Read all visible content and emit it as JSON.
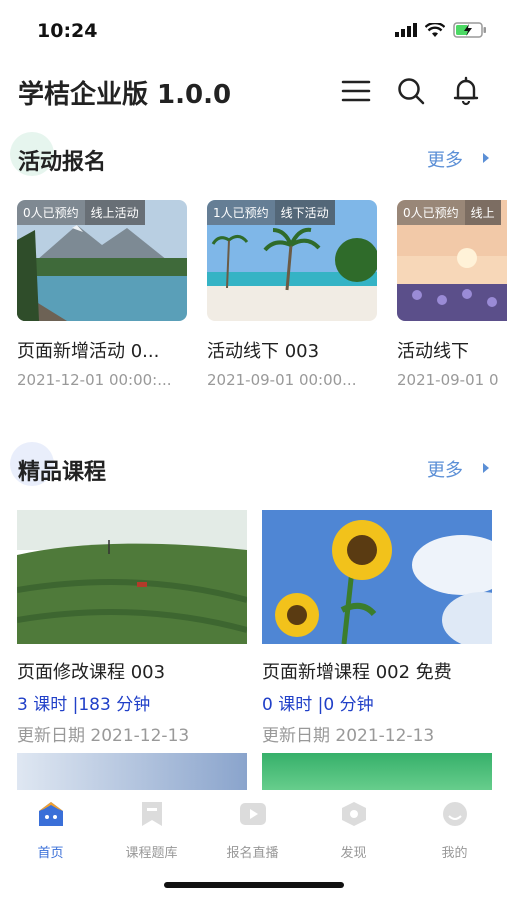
{
  "status_bar": {
    "time": "10:24"
  },
  "app": {
    "title": "学桔企业版 1.0.0"
  },
  "header_icons": [
    "menu-icon",
    "search-icon",
    "bell-icon"
  ],
  "colors": {
    "accent": "#3a6fd8",
    "more_link": "#5b8fd6",
    "course_meta": "#2140c8",
    "muted": "#999999"
  },
  "activities_section": {
    "title": "活动报名",
    "more": "更多",
    "items": [
      {
        "reserved": "0人已预约",
        "type": "线上活动",
        "name": "页面新增活动 0...",
        "date": "2021-12-01 00:00:..."
      },
      {
        "reserved": "1人已预约",
        "type": "线下活动",
        "name": "活动线下 003",
        "date": "2021-09-01 00:00..."
      },
      {
        "reserved": "0人已预约",
        "type": "线上",
        "name": "活动线下",
        "date": "2021-09-01 0"
      }
    ]
  },
  "courses_section": {
    "title": "精品课程",
    "more": "更多",
    "items": [
      {
        "name": "页面修改课程 003",
        "meta": "3 课时 |183 分钟",
        "date": "更新日期  2021-12-13"
      },
      {
        "name": "页面新增课程 002 免费",
        "meta": "0 课时 |0 分钟",
        "date": "更新日期  2021-12-13"
      }
    ]
  },
  "tabs": [
    {
      "label": "首页",
      "icon": "home-icon",
      "active": true
    },
    {
      "label": "课程题库",
      "icon": "bookmark-icon",
      "active": false
    },
    {
      "label": "报名直播",
      "icon": "play-icon",
      "active": false
    },
    {
      "label": "发现",
      "icon": "discover-icon",
      "active": false
    },
    {
      "label": "我的",
      "icon": "profile-icon",
      "active": false
    }
  ]
}
